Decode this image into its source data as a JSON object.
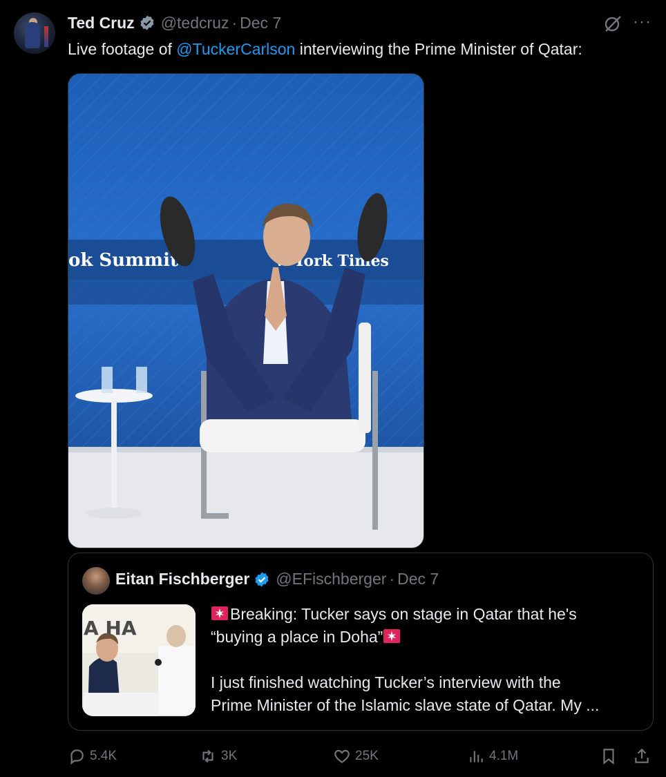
{
  "tweet": {
    "author_name": "Ted Cruz",
    "handle": "@tedcruz",
    "separator": "·",
    "date": "Dec 7",
    "text_before": "Live footage of ",
    "mention": "@TuckerCarlson",
    "text_after": " interviewing the Prime Minister of Qatar:",
    "media": {
      "banner_left": "ok Summit",
      "banner_right": "w York Times"
    }
  },
  "quote": {
    "author_name": "Eitan Fischberger",
    "handle": "@EFischberger",
    "separator": "·",
    "date": "Dec 7",
    "line1": "Breaking: Tucker says on stage in Qatar that he's",
    "line2": "“buying a place in Doha”",
    "line3": "I just finished watching Tucker’s interview with the",
    "line4": "Prime Minister of the Islamic slave state of Qatar. My ...",
    "thumb_text": "A   HA"
  },
  "actions": {
    "replies": "5.4K",
    "reposts": "3K",
    "likes": "25K",
    "views": "4.1M"
  },
  "colors": {
    "background": "#000000",
    "text": "#e7e9ea",
    "muted": "#71767b",
    "link": "#1d9bf0",
    "border": "#2f3336",
    "verified": "#1d9bf0"
  }
}
